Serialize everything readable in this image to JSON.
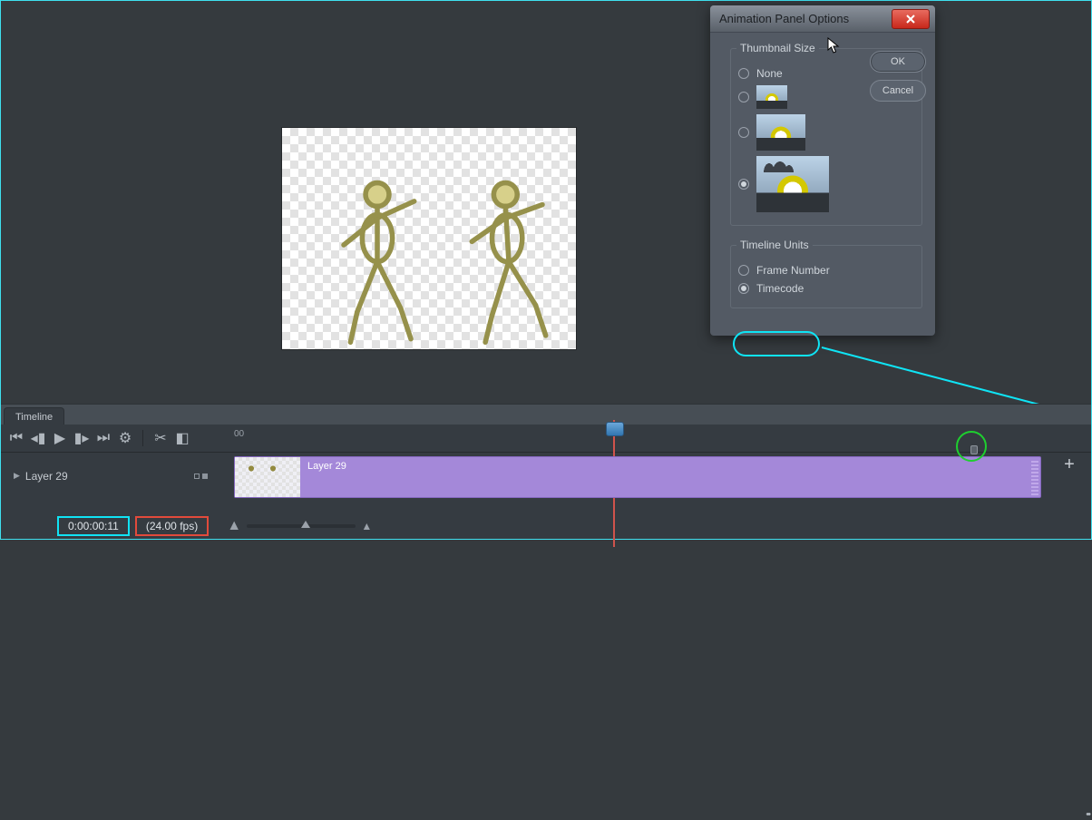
{
  "dialog": {
    "title": "Animation Panel Options",
    "thumb_legend": "Thumbnail Size",
    "thumb_none": "None",
    "units_legend": "Timeline Units",
    "units_frame": "Frame Number",
    "units_time": "Timecode",
    "ok": "OK",
    "cancel": "Cancel",
    "selected_thumb": "large",
    "selected_units": "timecode"
  },
  "timeline": {
    "panel_name": "Timeline",
    "layer_name": "Layer 29",
    "clip_name": "Layer 29",
    "ruler_start": "00",
    "timecode": "0:00:00:11",
    "fps": "(24.00 fps)"
  },
  "icons": {
    "close": "close-icon",
    "skipstart": "skip-start-icon",
    "prevfr": "prev-frame-icon",
    "play": "play-icon",
    "nextfr": "next-frame-icon",
    "skipend": "skip-end-icon",
    "gear": "gear-icon",
    "scissors": "scissors-icon",
    "trans": "transition-icon",
    "add": "add-icon",
    "mount1": "mountains-small-icon",
    "mount2": "mountains-large-icon",
    "caret": "caret-right-icon"
  }
}
